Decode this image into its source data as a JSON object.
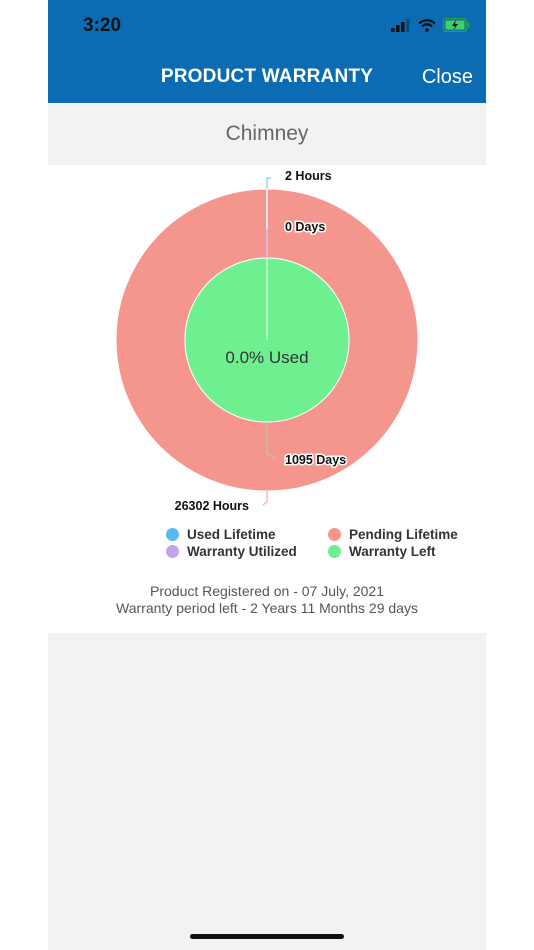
{
  "status": {
    "time": "3:20"
  },
  "header": {
    "title": "PRODUCT WARRANTY",
    "close_label": "Close"
  },
  "product": {
    "name": "Chimney"
  },
  "chart_data": {
    "type": "pie",
    "center_label": "0.0% Used",
    "outer_ring": {
      "slices": [
        {
          "name": "Used Lifetime",
          "value": 2,
          "label": "2 Hours",
          "color": "#5bb8f0"
        },
        {
          "name": "Pending Lifetime",
          "value": 26302,
          "label": "26302 Hours",
          "color": "#f5968e"
        }
      ]
    },
    "inner_ring": {
      "slices": [
        {
          "name": "Warranty Utilized",
          "value": 0,
          "label": "0 Days",
          "color": "#c3a2ee"
        },
        {
          "name": "Warranty Left",
          "value": 1095,
          "label": "1095 Days",
          "color": "#6ef090"
        }
      ]
    },
    "legend": [
      {
        "label": "Used Lifetime",
        "color": "#5bb8f0"
      },
      {
        "label": "Pending Lifetime",
        "color": "#f5968e"
      },
      {
        "label": "Warranty Utilized",
        "color": "#c3a2ee"
      },
      {
        "label": "Warranty Left",
        "color": "#6ef090"
      }
    ]
  },
  "info": {
    "registered": "Product Registered on - 07 July, 2021",
    "period_left": "Warranty period left - 2 Years 11 Months 29 days"
  }
}
